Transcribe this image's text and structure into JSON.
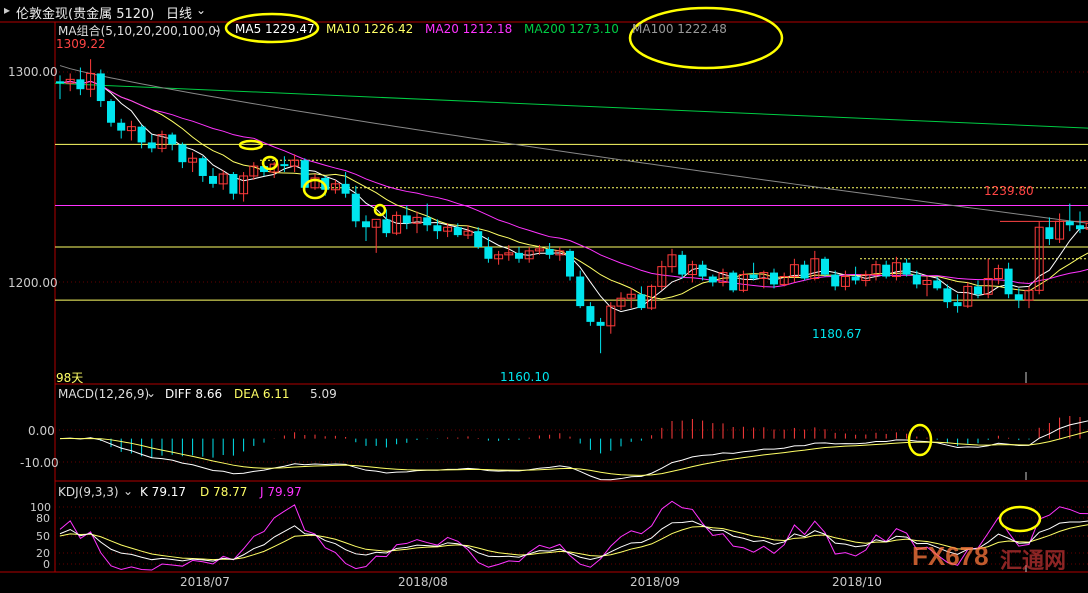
{
  "window": {
    "title": "伦敦金现(贵金属 5120)",
    "period": "日线",
    "colors": {
      "bg": "#000000",
      "up": "#ff3b3b",
      "down": "#00e5ee",
      "frame": "#b00000"
    }
  },
  "main": {
    "indicator_label": "MA组合(5,10,20,200,100,0)",
    "ma_values": [
      {
        "name": "MA5",
        "value": "1229.47",
        "color": "#ffffff"
      },
      {
        "name": "MA10",
        "value": "1226.42",
        "color": "#ffff66"
      },
      {
        "name": "MA20",
        "value": "1212.18",
        "color": "#ff33ff"
      },
      {
        "name": "MA200",
        "value": "1273.10",
        "color": "#00cc44"
      },
      {
        "name": "MA100",
        "value": "1222.48",
        "color": "#999999"
      }
    ],
    "y_ticks": [
      "1300.00",
      "1200.00"
    ],
    "price_labels": {
      "high_start": "1309.22",
      "low1": "1160.10",
      "low2": "1180.67",
      "last_high": "1239.80"
    },
    "days_label": "98天"
  },
  "macd": {
    "label": "MACD(12,26,9)",
    "diff": "DIFF 8.66",
    "dea": "DEA 6.11",
    "macd": "5.09",
    "y_ticks": [
      "0.00",
      "-10.00"
    ]
  },
  "kdj": {
    "label": "KDJ(9,3,3)",
    "k": "K 79.17",
    "d": "D 78.77",
    "j": "J 79.97",
    "y_ticks": [
      "100",
      "80",
      "50",
      "20",
      "0"
    ]
  },
  "x_axis": {
    "labels": [
      "2018/07",
      "2018/08",
      "2018/09",
      "2018/10"
    ]
  },
  "watermark": {
    "brand": "FX678",
    "cn": "汇通网"
  },
  "chart_data": {
    "type": "candlestick",
    "x_range": [
      "2018/06/13",
      "2018/10/19"
    ],
    "y_range_main": [
      1145,
      1322
    ],
    "y_range_macd": [
      -15,
      14
    ],
    "y_range_kdj": [
      -5,
      112
    ],
    "horizontal_lines": [
      1266,
      1258,
      1244,
      1235,
      1214,
      1208,
      1187
    ],
    "levels": {
      "ma200_start": 1297,
      "ma200_end": 1273.1,
      "ma100_start": 1306,
      "ma100_end": 1222.5
    },
    "ohlc": [
      [
        1298,
        1301,
        1289,
        1297
      ],
      [
        1297,
        1302,
        1293,
        1299
      ],
      [
        1299,
        1305,
        1291,
        1294
      ],
      [
        1294,
        1309.22,
        1290,
        1302
      ],
      [
        1302,
        1304,
        1285,
        1288
      ],
      [
        1288,
        1289,
        1275,
        1277
      ],
      [
        1277,
        1279,
        1269,
        1273
      ],
      [
        1273,
        1278,
        1268,
        1275
      ],
      [
        1275,
        1276,
        1264,
        1267
      ],
      [
        1267,
        1271,
        1262,
        1264
      ],
      [
        1264,
        1273,
        1262,
        1271
      ],
      [
        1271,
        1272,
        1263,
        1266
      ],
      [
        1266,
        1267,
        1254,
        1257
      ],
      [
        1257,
        1262,
        1252,
        1259
      ],
      [
        1259,
        1260,
        1247,
        1250
      ],
      [
        1250,
        1254,
        1244,
        1246
      ],
      [
        1246,
        1253,
        1243,
        1251
      ],
      [
        1251,
        1252,
        1238,
        1241
      ],
      [
        1241,
        1252,
        1237,
        1250
      ],
      [
        1250,
        1257,
        1248,
        1255
      ],
      [
        1255,
        1258,
        1250,
        1252
      ],
      [
        1252,
        1257,
        1249,
        1256
      ],
      [
        1256,
        1260,
        1252,
        1255
      ],
      [
        1255,
        1261,
        1252,
        1258
      ],
      [
        1258,
        1259,
        1242,
        1244
      ],
      [
        1244,
        1251,
        1243,
        1249
      ],
      [
        1249,
        1250,
        1240,
        1243
      ],
      [
        1243,
        1248,
        1241,
        1246
      ],
      [
        1246,
        1252,
        1239,
        1241
      ],
      [
        1241,
        1245,
        1224,
        1227
      ],
      [
        1227,
        1230,
        1217,
        1224
      ],
      [
        1224,
        1227,
        1211,
        1228
      ],
      [
        1228,
        1233,
        1219,
        1221
      ],
      [
        1221,
        1232,
        1220,
        1230
      ],
      [
        1230,
        1235,
        1223,
        1226
      ],
      [
        1226,
        1232,
        1221,
        1229
      ],
      [
        1229,
        1236,
        1222,
        1225
      ],
      [
        1225,
        1228,
        1218,
        1222
      ],
      [
        1222,
        1226,
        1219,
        1224
      ],
      [
        1224,
        1226,
        1219,
        1220
      ],
      [
        1220,
        1225,
        1218,
        1222
      ],
      [
        1222,
        1224,
        1213,
        1214
      ],
      [
        1214,
        1219,
        1206,
        1208
      ],
      [
        1208,
        1212,
        1205,
        1210
      ],
      [
        1210,
        1215,
        1207,
        1211
      ],
      [
        1211,
        1214,
        1206,
        1208
      ],
      [
        1208,
        1214,
        1206,
        1212
      ],
      [
        1212,
        1215,
        1210,
        1213
      ],
      [
        1213,
        1216,
        1208,
        1210
      ],
      [
        1210,
        1214,
        1207,
        1212
      ],
      [
        1212,
        1213,
        1197,
        1199
      ],
      [
        1199,
        1202,
        1183,
        1184
      ],
      [
        1184,
        1186,
        1174,
        1176
      ],
      [
        1176,
        1178,
        1160.1,
        1174
      ],
      [
        1174,
        1186,
        1170,
        1184
      ],
      [
        1184,
        1191,
        1182,
        1188
      ],
      [
        1188,
        1193,
        1183,
        1190
      ],
      [
        1190,
        1194,
        1182,
        1183
      ],
      [
        1183,
        1195,
        1182,
        1194
      ],
      [
        1194,
        1207,
        1192,
        1204
      ],
      [
        1204,
        1213,
        1201,
        1210
      ],
      [
        1210,
        1212,
        1198,
        1200
      ],
      [
        1200,
        1207,
        1196,
        1205
      ],
      [
        1205,
        1207,
        1197,
        1199
      ],
      [
        1199,
        1200,
        1194,
        1196
      ],
      [
        1196,
        1203,
        1194,
        1201
      ],
      [
        1201,
        1202,
        1191,
        1192
      ],
      [
        1192,
        1202,
        1191,
        1200
      ],
      [
        1200,
        1206,
        1197,
        1198
      ],
      [
        1198,
        1202,
        1193,
        1201
      ],
      [
        1201,
        1203,
        1193,
        1195
      ],
      [
        1195,
        1201,
        1194,
        1199
      ],
      [
        1199,
        1208,
        1196,
        1205
      ],
      [
        1205,
        1207,
        1197,
        1198
      ],
      [
        1198,
        1212,
        1197,
        1208
      ],
      [
        1208,
        1209,
        1199,
        1200
      ],
      [
        1200,
        1202,
        1192,
        1194
      ],
      [
        1194,
        1202,
        1192,
        1199
      ],
      [
        1199,
        1204,
        1195,
        1197
      ],
      [
        1197,
        1202,
        1194,
        1200
      ],
      [
        1200,
        1207,
        1197,
        1205
      ],
      [
        1205,
        1207,
        1198,
        1199
      ],
      [
        1199,
        1209,
        1197,
        1206
      ],
      [
        1206,
        1208,
        1199,
        1200
      ],
      [
        1200,
        1202,
        1193,
        1195
      ],
      [
        1195,
        1199,
        1189,
        1197
      ],
      [
        1197,
        1199,
        1192,
        1193
      ],
      [
        1193,
        1195,
        1183,
        1186
      ],
      [
        1186,
        1190,
        1180.67,
        1184
      ],
      [
        1184,
        1196,
        1183,
        1194
      ],
      [
        1194,
        1197,
        1188,
        1190
      ],
      [
        1190,
        1208,
        1188,
        1198
      ],
      [
        1198,
        1205,
        1195,
        1203
      ],
      [
        1203,
        1206,
        1188,
        1190
      ],
      [
        1190,
        1193,
        1183,
        1187
      ],
      [
        1187,
        1194,
        1183,
        1192
      ],
      [
        1192,
        1227,
        1190,
        1224
      ],
      [
        1224,
        1229,
        1215,
        1218
      ],
      [
        1218,
        1231,
        1216,
        1227
      ],
      [
        1227,
        1236,
        1222,
        1225
      ],
      [
        1225,
        1232,
        1221,
        1223
      ],
      [
        1223,
        1228,
        1220,
        1226
      ],
      [
        1226,
        1231,
        1222,
        1224
      ],
      [
        1224,
        1236,
        1222,
        1229
      ],
      [
        1229,
        1234,
        1222,
        1223
      ],
      [
        1223,
        1239.8,
        1221,
        1232
      ],
      [
        1232,
        1236,
        1229,
        1234
      ]
    ]
  }
}
